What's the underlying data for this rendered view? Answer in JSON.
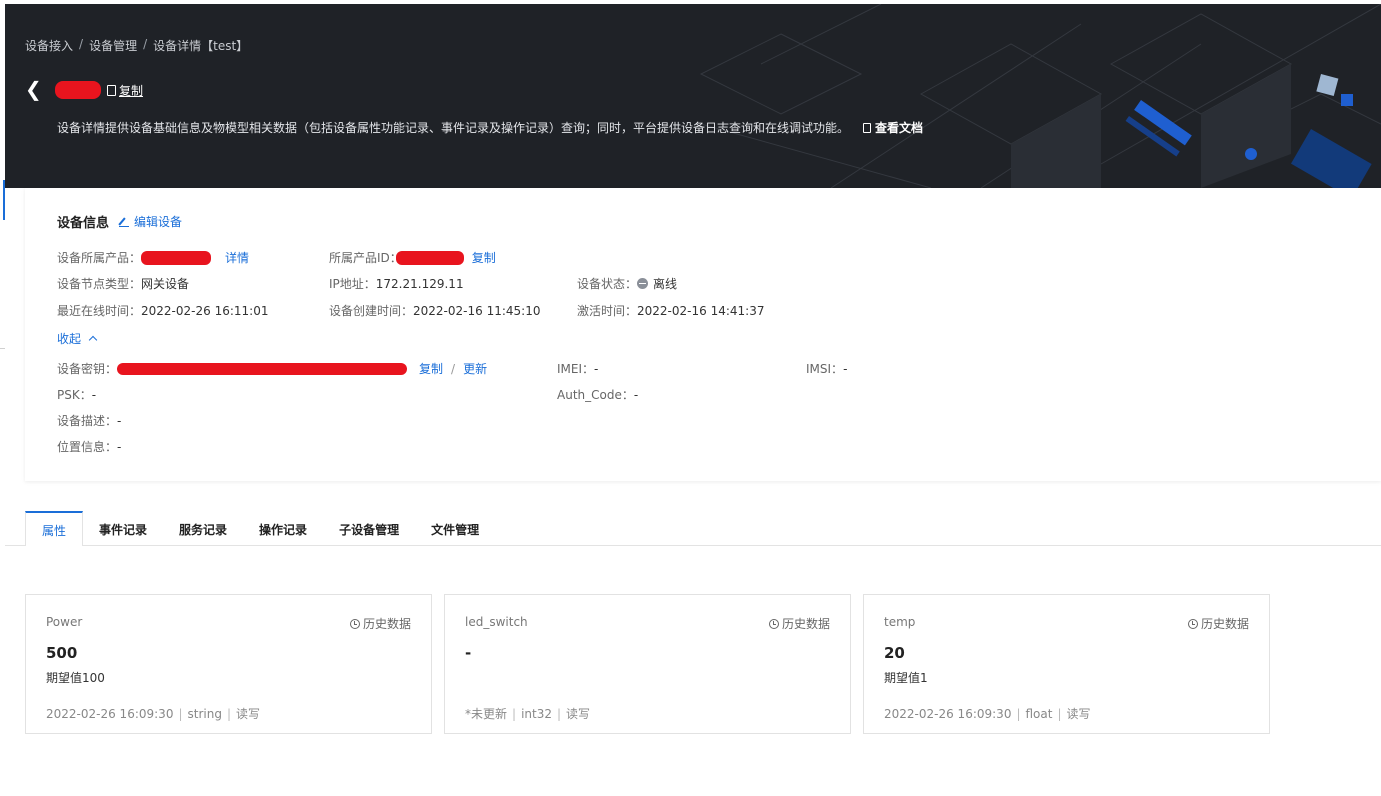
{
  "breadcrumb": [
    "设备接入",
    "设备管理",
    "设备详情【test】"
  ],
  "header": {
    "copy_label": "复制",
    "description": "设备详情提供设备基础信息及物模型相关数据（包括设备属性功能记录、事件记录及操作记录）查询；同时，平台提供设备日志查询和在线调试功能。",
    "doc_link": "查看文档"
  },
  "info": {
    "title": "设备信息",
    "edit_label": "编辑设备",
    "product_label": "设备所属产品：",
    "product_detail": "详情",
    "product_id_label": "所属产品ID：",
    "product_id_copy": "复制",
    "node_type_label": "设备节点类型：",
    "node_type_value": "网关设备",
    "ip_label": "IP地址：",
    "ip_value": "172.21.129.11",
    "status_label": "设备状态：",
    "status_value": "离线",
    "last_online_label": "最近在线时间：",
    "last_online_value": "2022-02-26 16:11:01",
    "created_label": "设备创建时间：",
    "created_value": "2022-02-16 11:45:10",
    "activated_label": "激活时间：",
    "activated_value": "2022-02-16 14:41:37",
    "collapse_label": "收起",
    "secret_label": "设备密钥：",
    "secret_copy": "复制",
    "secret_update": "更新",
    "imei_label": "IMEI：",
    "imei_value": "-",
    "imsi_label": "IMSI：",
    "imsi_value": "-",
    "psk_label": "PSK：",
    "psk_value": "-",
    "auth_label": "Auth_Code：",
    "auth_value": "-",
    "desc_label": "设备描述：",
    "desc_value": "-",
    "location_label": "位置信息：",
    "location_value": "-"
  },
  "tabs": [
    {
      "label": "属性",
      "active": true
    },
    {
      "label": "事件记录"
    },
    {
      "label": "服务记录"
    },
    {
      "label": "操作记录"
    },
    {
      "label": "子设备管理"
    },
    {
      "label": "文件管理"
    }
  ],
  "properties": [
    {
      "name": "Power",
      "history": "历史数据",
      "value": "500",
      "expect": "期望值100",
      "time": "2022-02-26 16:09:30",
      "type": "string",
      "access": "读写"
    },
    {
      "name": "led_switch",
      "history": "历史数据",
      "value": "-",
      "expect": "",
      "time": "*未更新",
      "type": "int32",
      "access": "读写"
    },
    {
      "name": "temp",
      "history": "历史数据",
      "value": "20",
      "expect": "期望值1",
      "time": "2022-02-26 16:09:30",
      "type": "float",
      "access": "读写"
    }
  ],
  "colors": {
    "accent": "#1a6ed8",
    "banner": "#1f2227",
    "redaction": "#e8141e"
  }
}
